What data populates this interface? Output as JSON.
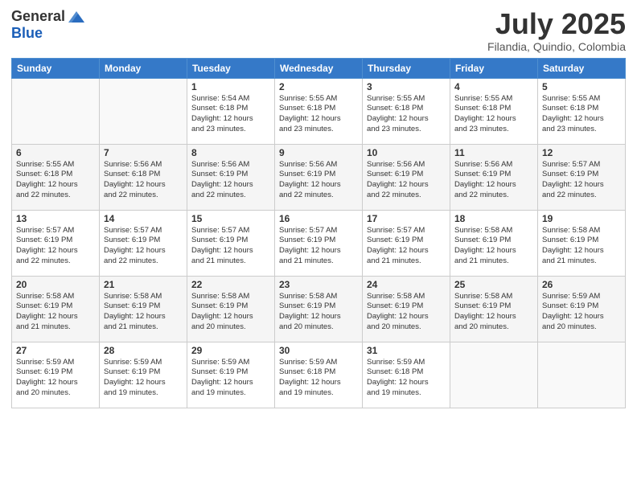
{
  "header": {
    "logo_general": "General",
    "logo_blue": "Blue",
    "month": "July 2025",
    "location": "Filandia, Quindio, Colombia"
  },
  "days_of_week": [
    "Sunday",
    "Monday",
    "Tuesday",
    "Wednesday",
    "Thursday",
    "Friday",
    "Saturday"
  ],
  "weeks": [
    [
      {
        "day": "",
        "info": ""
      },
      {
        "day": "",
        "info": ""
      },
      {
        "day": "1",
        "sunrise": "5:54 AM",
        "sunset": "6:18 PM",
        "daylight": "12 hours and 23 minutes."
      },
      {
        "day": "2",
        "sunrise": "5:55 AM",
        "sunset": "6:18 PM",
        "daylight": "12 hours and 23 minutes."
      },
      {
        "day": "3",
        "sunrise": "5:55 AM",
        "sunset": "6:18 PM",
        "daylight": "12 hours and 23 minutes."
      },
      {
        "day": "4",
        "sunrise": "5:55 AM",
        "sunset": "6:18 PM",
        "daylight": "12 hours and 23 minutes."
      },
      {
        "day": "5",
        "sunrise": "5:55 AM",
        "sunset": "6:18 PM",
        "daylight": "12 hours and 23 minutes."
      }
    ],
    [
      {
        "day": "6",
        "sunrise": "5:55 AM",
        "sunset": "6:18 PM",
        "daylight": "12 hours and 22 minutes."
      },
      {
        "day": "7",
        "sunrise": "5:56 AM",
        "sunset": "6:18 PM",
        "daylight": "12 hours and 22 minutes."
      },
      {
        "day": "8",
        "sunrise": "5:56 AM",
        "sunset": "6:19 PM",
        "daylight": "12 hours and 22 minutes."
      },
      {
        "day": "9",
        "sunrise": "5:56 AM",
        "sunset": "6:19 PM",
        "daylight": "12 hours and 22 minutes."
      },
      {
        "day": "10",
        "sunrise": "5:56 AM",
        "sunset": "6:19 PM",
        "daylight": "12 hours and 22 minutes."
      },
      {
        "day": "11",
        "sunrise": "5:56 AM",
        "sunset": "6:19 PM",
        "daylight": "12 hours and 22 minutes."
      },
      {
        "day": "12",
        "sunrise": "5:57 AM",
        "sunset": "6:19 PM",
        "daylight": "12 hours and 22 minutes."
      }
    ],
    [
      {
        "day": "13",
        "sunrise": "5:57 AM",
        "sunset": "6:19 PM",
        "daylight": "12 hours and 22 minutes."
      },
      {
        "day": "14",
        "sunrise": "5:57 AM",
        "sunset": "6:19 PM",
        "daylight": "12 hours and 22 minutes."
      },
      {
        "day": "15",
        "sunrise": "5:57 AM",
        "sunset": "6:19 PM",
        "daylight": "12 hours and 21 minutes."
      },
      {
        "day": "16",
        "sunrise": "5:57 AM",
        "sunset": "6:19 PM",
        "daylight": "12 hours and 21 minutes."
      },
      {
        "day": "17",
        "sunrise": "5:57 AM",
        "sunset": "6:19 PM",
        "daylight": "12 hours and 21 minutes."
      },
      {
        "day": "18",
        "sunrise": "5:58 AM",
        "sunset": "6:19 PM",
        "daylight": "12 hours and 21 minutes."
      },
      {
        "day": "19",
        "sunrise": "5:58 AM",
        "sunset": "6:19 PM",
        "daylight": "12 hours and 21 minutes."
      }
    ],
    [
      {
        "day": "20",
        "sunrise": "5:58 AM",
        "sunset": "6:19 PM",
        "daylight": "12 hours and 21 minutes."
      },
      {
        "day": "21",
        "sunrise": "5:58 AM",
        "sunset": "6:19 PM",
        "daylight": "12 hours and 21 minutes."
      },
      {
        "day": "22",
        "sunrise": "5:58 AM",
        "sunset": "6:19 PM",
        "daylight": "12 hours and 20 minutes."
      },
      {
        "day": "23",
        "sunrise": "5:58 AM",
        "sunset": "6:19 PM",
        "daylight": "12 hours and 20 minutes."
      },
      {
        "day": "24",
        "sunrise": "5:58 AM",
        "sunset": "6:19 PM",
        "daylight": "12 hours and 20 minutes."
      },
      {
        "day": "25",
        "sunrise": "5:58 AM",
        "sunset": "6:19 PM",
        "daylight": "12 hours and 20 minutes."
      },
      {
        "day": "26",
        "sunrise": "5:59 AM",
        "sunset": "6:19 PM",
        "daylight": "12 hours and 20 minutes."
      }
    ],
    [
      {
        "day": "27",
        "sunrise": "5:59 AM",
        "sunset": "6:19 PM",
        "daylight": "12 hours and 20 minutes."
      },
      {
        "day": "28",
        "sunrise": "5:59 AM",
        "sunset": "6:19 PM",
        "daylight": "12 hours and 19 minutes."
      },
      {
        "day": "29",
        "sunrise": "5:59 AM",
        "sunset": "6:19 PM",
        "daylight": "12 hours and 19 minutes."
      },
      {
        "day": "30",
        "sunrise": "5:59 AM",
        "sunset": "6:18 PM",
        "daylight": "12 hours and 19 minutes."
      },
      {
        "day": "31",
        "sunrise": "5:59 AM",
        "sunset": "6:18 PM",
        "daylight": "12 hours and 19 minutes."
      },
      {
        "day": "",
        "info": ""
      },
      {
        "day": "",
        "info": ""
      }
    ]
  ],
  "labels": {
    "sunrise": "Sunrise:",
    "sunset": "Sunset:",
    "daylight": "Daylight:"
  }
}
